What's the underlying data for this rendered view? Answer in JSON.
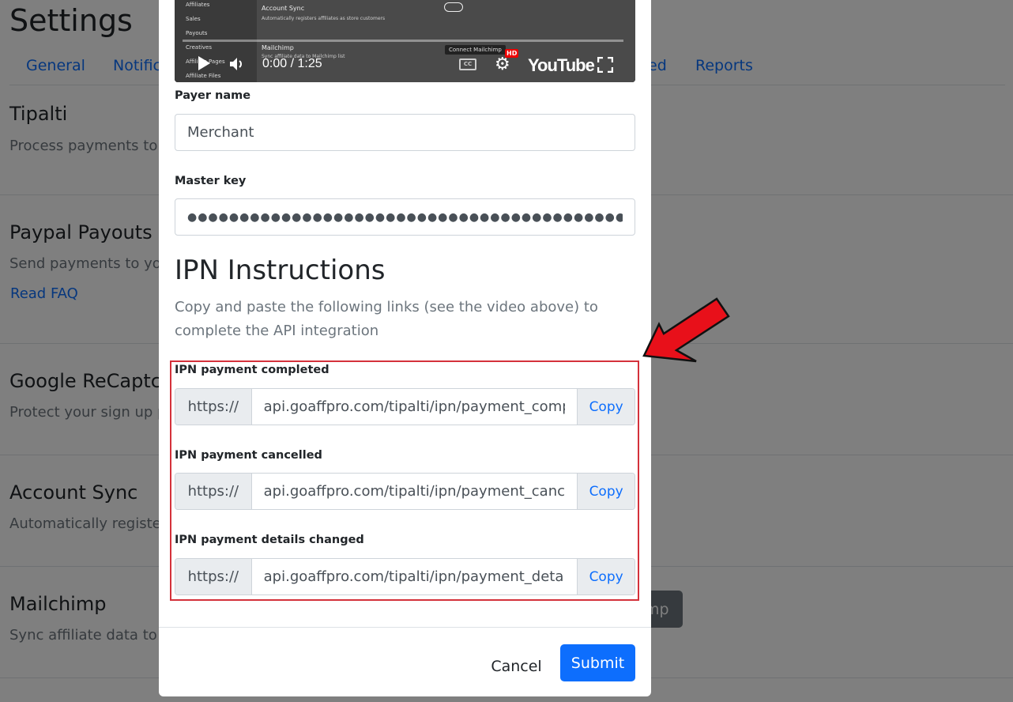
{
  "page": {
    "title": "Settings",
    "tabs": [
      "General",
      "Notific",
      "ed",
      "Reports"
    ],
    "sections": [
      {
        "title": "Tipalti",
        "desc": "Process payments to y"
      },
      {
        "title": "Paypal Payouts",
        "desc": "Send payments to you",
        "link": "Read FAQ"
      },
      {
        "title": "Google ReCaptch",
        "desc": "Protect your sign up p"
      },
      {
        "title": "Account Sync",
        "desc": "Automatically register"
      },
      {
        "title": "Mailchimp",
        "desc": "Sync affiliate data to a",
        "button": "mp"
      }
    ]
  },
  "video": {
    "sidebar_items": [
      "Affiliates",
      "Sales",
      "Payouts",
      "Creatives",
      "Affiliate Pages",
      "Affiliate Files"
    ],
    "setting_title": "Account Sync",
    "setting_desc": "Automatically registers affiliates as store customers",
    "setting2_title": "Mailchimp",
    "setting2_desc": "Sync affiliate data to Mailchimp list",
    "tooltip": "Connect Mailchimp",
    "time": "0:00 / 1:25",
    "hd": "HD",
    "cc": "CC",
    "logo": "YouTube"
  },
  "modal": {
    "payer_name_label": "Payer name",
    "payer_name_value": "Merchant",
    "master_key_label": "Master key",
    "master_key_value": "●●●●●●●●●●●●●●●●●●●●●●●●●●●●●●●●●●●●●●●●●●●●●●●●",
    "ipn_title": "IPN Instructions",
    "ipn_desc": "Copy and paste the following links (see the video above) to complete the API integration",
    "ipn_fields": [
      {
        "label": "IPN payment completed",
        "prefix": "https://",
        "value": "api.goaffpro.com/tipalti/ipn/payment_completed",
        "copy": "Copy"
      },
      {
        "label": "IPN payment cancelled",
        "prefix": "https://",
        "value": "api.goaffpro.com/tipalti/ipn/payment_cancelled",
        "copy": "Copy"
      },
      {
        "label": "IPN payment details changed",
        "prefix": "https://",
        "value": "api.goaffpro.com/tipalti/ipn/payment_details_changed",
        "copy": "Copy"
      }
    ],
    "cancel_label": "Cancel",
    "submit_label": "Submit"
  },
  "colors": {
    "accent": "#0d6efd",
    "highlight_border": "#d4313b",
    "arrow": "#e8101a"
  }
}
